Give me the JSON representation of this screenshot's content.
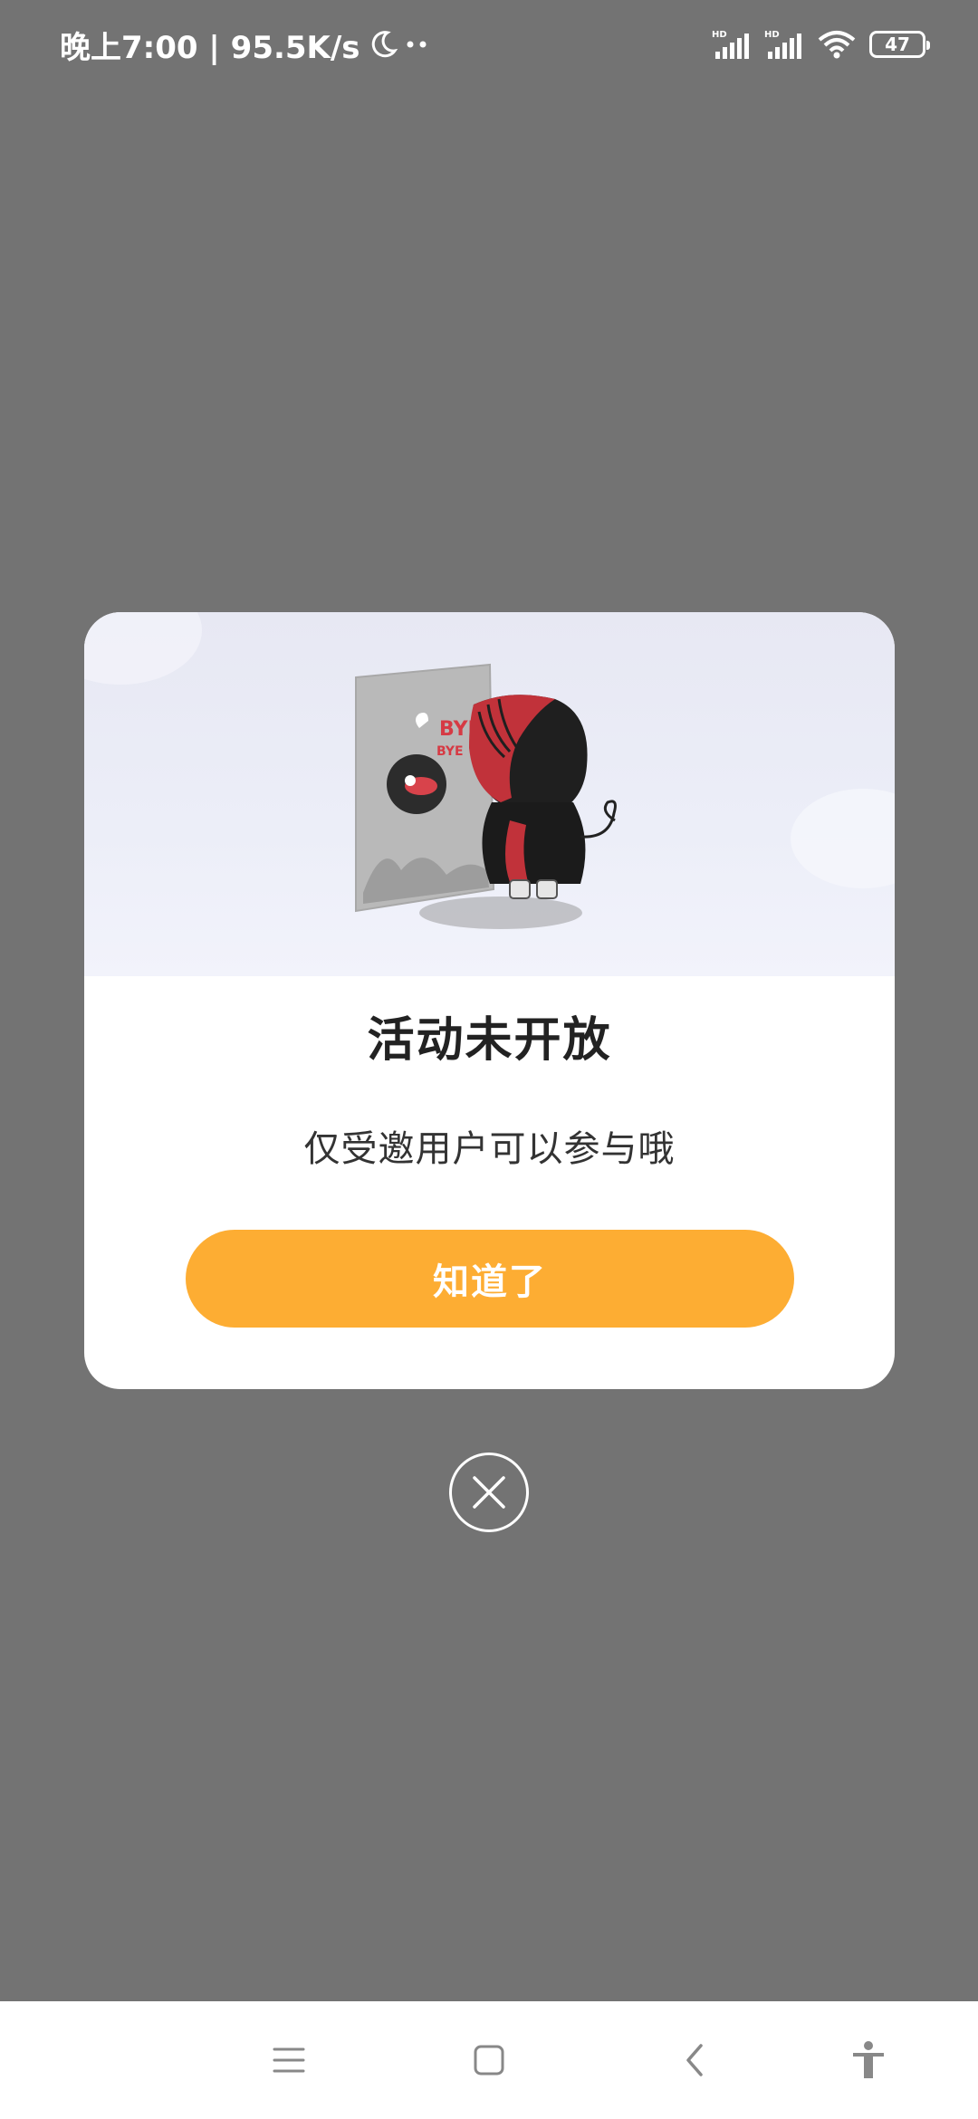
{
  "status_bar": {
    "time_and_speed": "晚上7:00 | 95.5K/s",
    "battery_level": "47",
    "icons": [
      "moon-icon",
      "more-dots-icon",
      "hd-signal-icon",
      "hd-signal-icon",
      "wifi-icon",
      "battery-icon"
    ]
  },
  "dialog": {
    "title": "活动未开放",
    "message": "仅受邀用户可以参与哦",
    "confirm_label": "知道了",
    "illustration": {
      "sign_text_large": "BYE",
      "sign_text_small": "BYE"
    },
    "close_icon": "close-icon"
  },
  "nav_bar": {
    "icons": [
      "menu-icon",
      "home-square-icon",
      "back-chevron-icon",
      "accessibility-icon"
    ]
  },
  "colors": {
    "overlay": "#737373",
    "accent": "#fdad33",
    "dialog_bg": "#ffffff"
  }
}
